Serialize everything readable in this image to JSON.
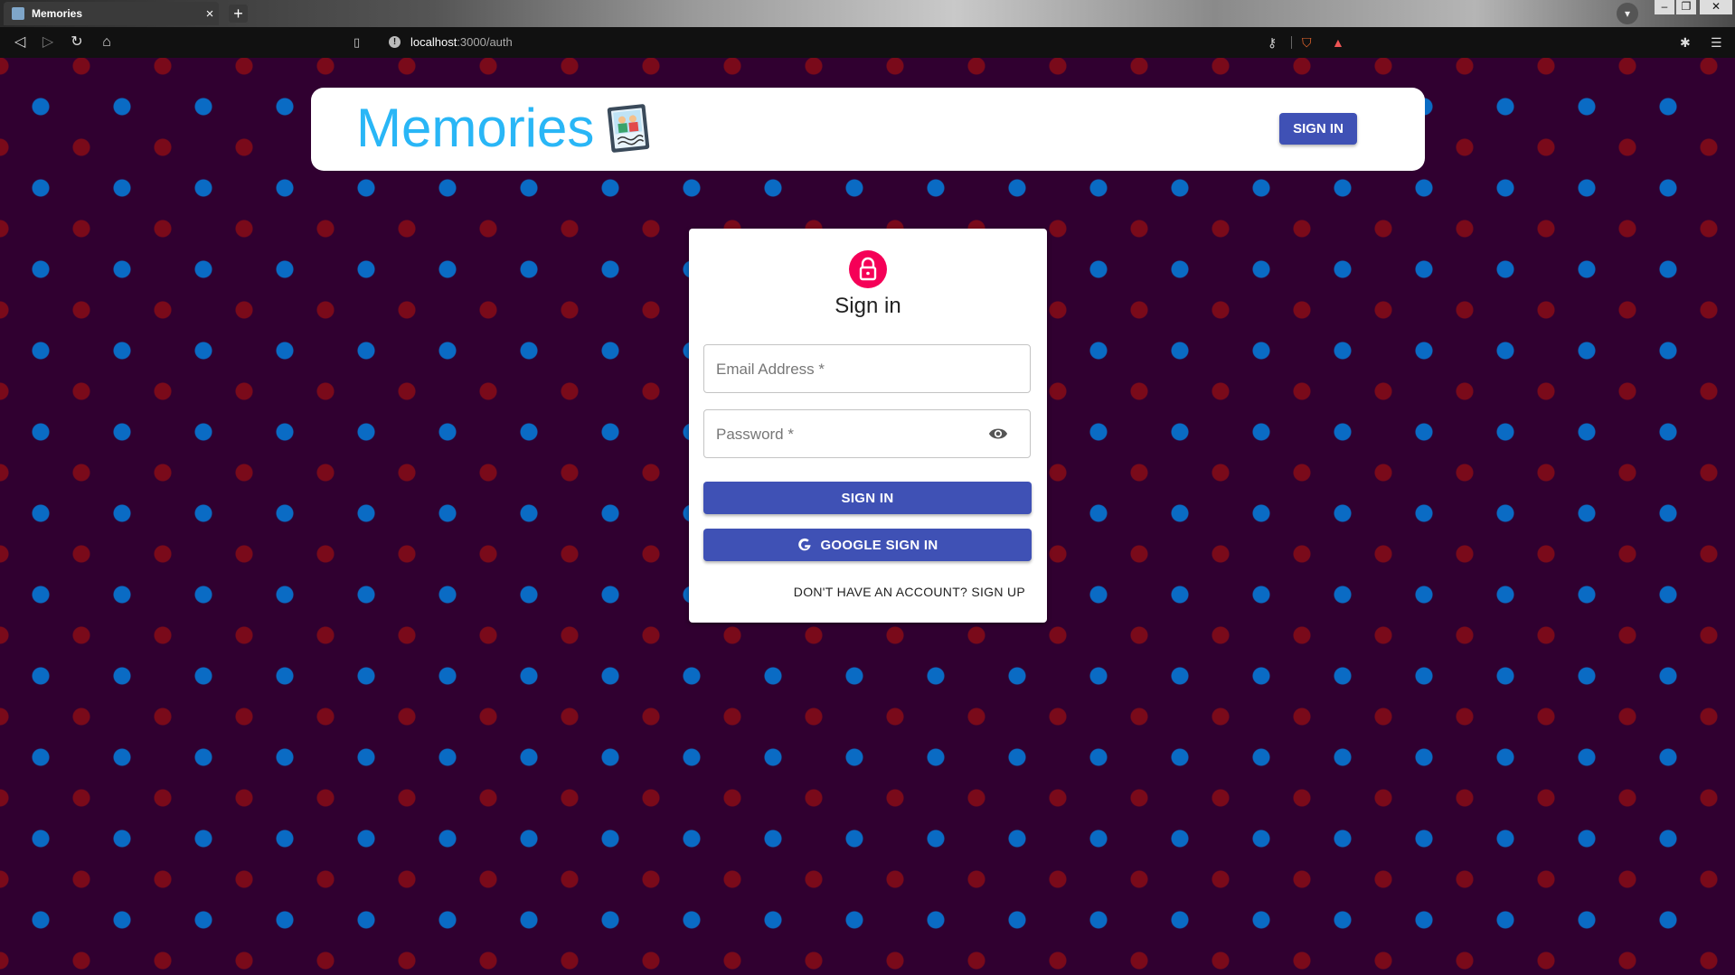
{
  "browser": {
    "tab_title": "Memories",
    "tab_close": "×",
    "new_tab": "+",
    "url_host": "localhost",
    "url_path": ":3000/auth",
    "window_controls": [
      "–",
      "❐",
      "✕"
    ]
  },
  "appbar": {
    "brand_text": "Memories",
    "sign_in_label": "SIGN IN"
  },
  "auth_card": {
    "title": "Sign in",
    "email_placeholder": "Email Address *",
    "password_placeholder": "Password *",
    "sign_in_label": "SIGN IN",
    "google_sign_in_label": "GOOGLE SIGN IN",
    "switch_mode_label": "DON'T HAVE AN ACCOUNT? SIGN UP"
  },
  "colors": {
    "page_background": "#300030",
    "dot_blue": "#0a6bc4",
    "dot_red": "#7a0a1a",
    "brand_text": "#29b6f6",
    "primary": "#3f51b5",
    "avatar": "#f50057"
  },
  "icons": {
    "lock": "lock-icon",
    "visibility": "eye-icon",
    "google": "google-g-icon",
    "brand_image": "photo-memories-icon"
  }
}
